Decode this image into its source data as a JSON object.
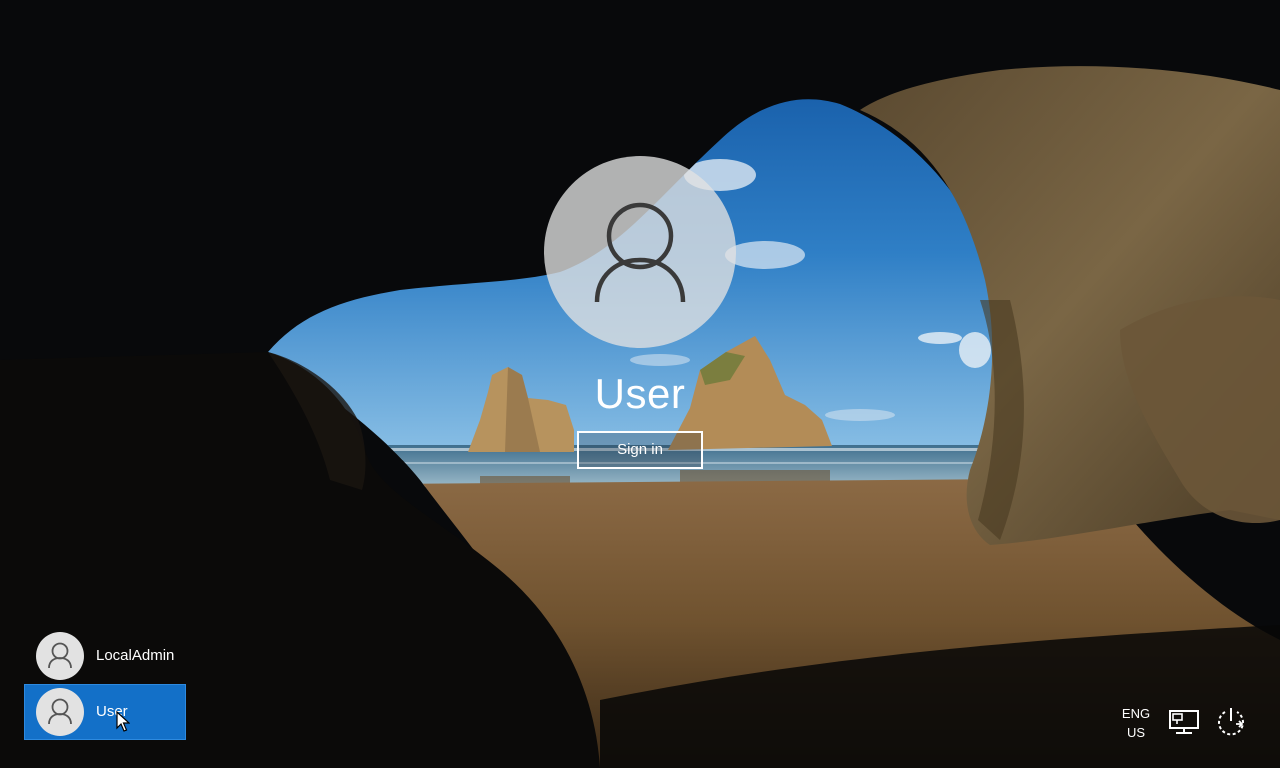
{
  "lock_screen": {
    "selected_user": "User",
    "signin_label": "Sign in"
  },
  "user_list": [
    {
      "name": "LocalAdmin",
      "selected": false,
      "icon": "user-avatar-icon"
    },
    {
      "name": "User",
      "selected": true,
      "icon": "user-avatar-icon"
    }
  ],
  "tray": {
    "language_line1": "ENG",
    "language_line2": "US",
    "network_icon": "network-icon",
    "power_icon": "power-icon"
  },
  "colors": {
    "selected_tile": "#1370c8",
    "text": "#ffffff"
  }
}
